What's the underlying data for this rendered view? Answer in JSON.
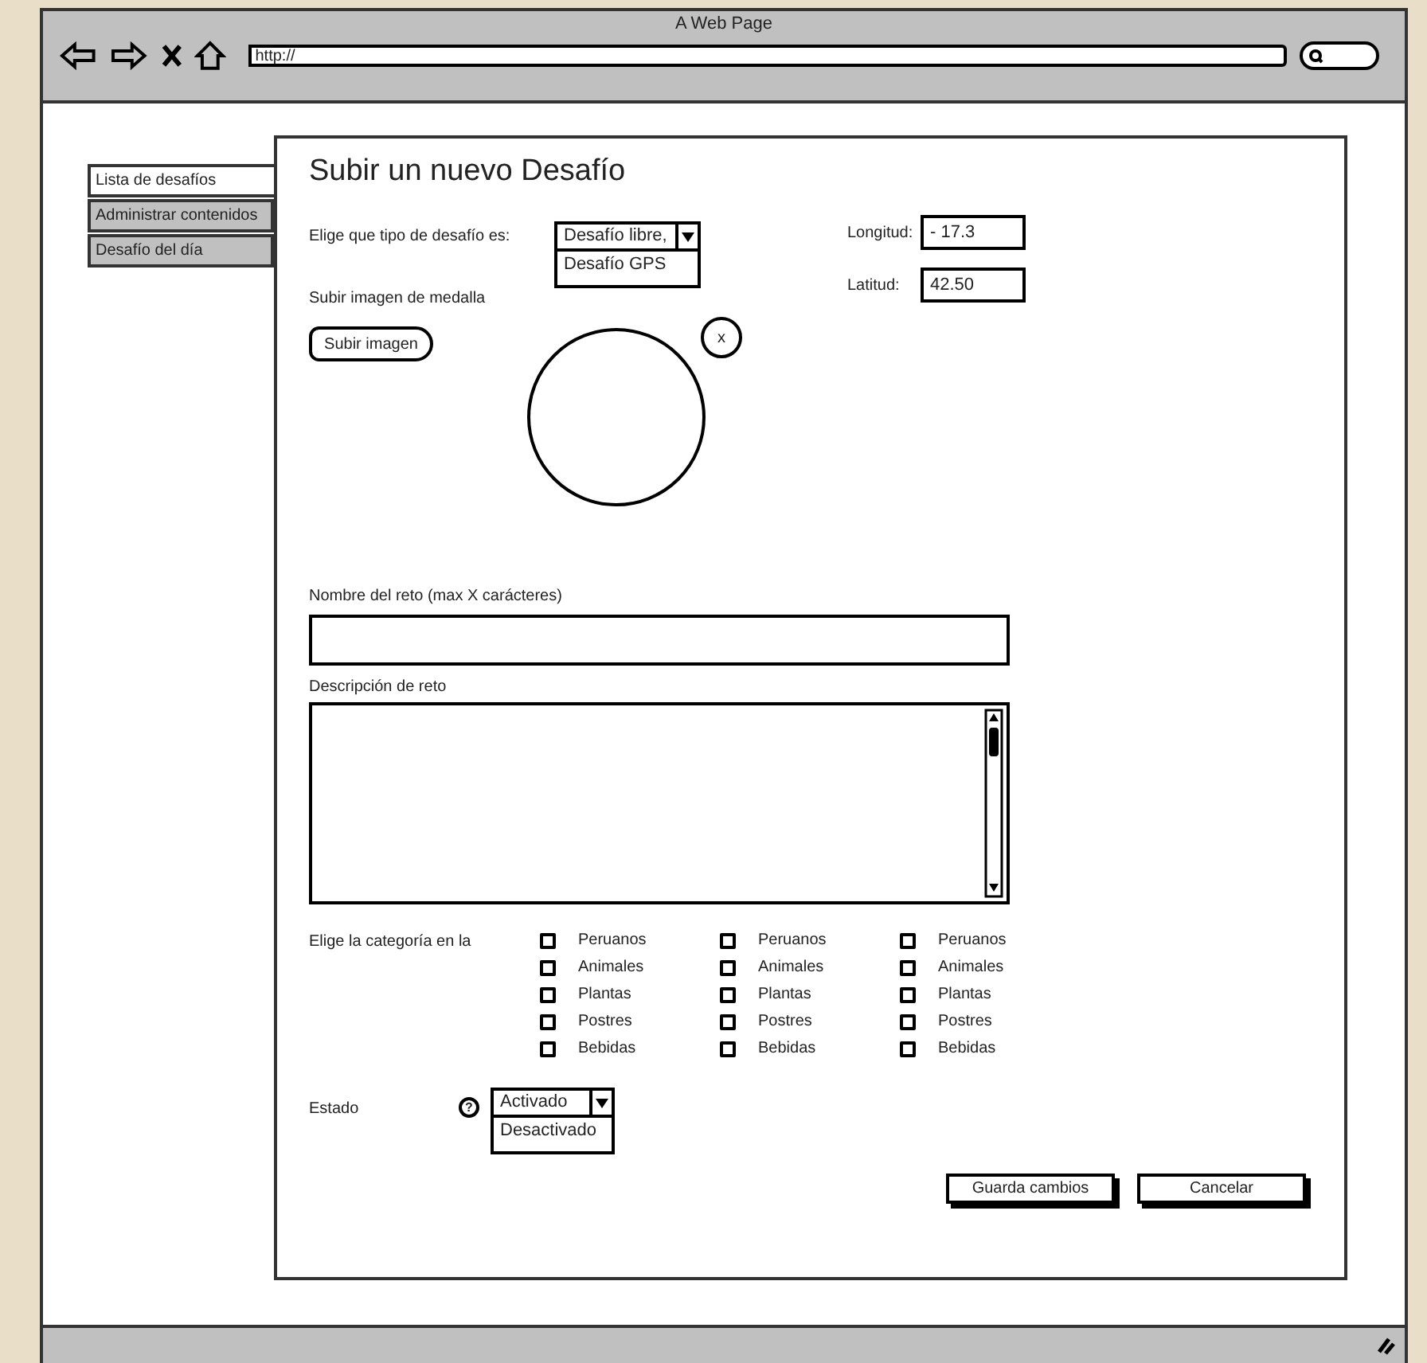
{
  "window": {
    "title": "A Web Page",
    "address": "http://"
  },
  "sidebar": {
    "tabs": [
      {
        "label": "Lista de desafíos",
        "selected": true
      },
      {
        "label": "Administrar contenidos",
        "selected": false
      },
      {
        "label": "Desafío del día",
        "selected": false
      }
    ]
  },
  "form": {
    "title": "Subir un nuevo Desafío",
    "type": {
      "label": "Elige que tipo de desafío es:",
      "value": "Desafío libre,",
      "options": [
        "Desafío GPS"
      ]
    },
    "longitude": {
      "label": "Longitud:",
      "value": "- 17.3"
    },
    "latitude": {
      "label": "Latitud:",
      "value": "42.50"
    },
    "medal": {
      "label": "Subir imagen de medalla",
      "button": "Subir imagen",
      "remove": "x"
    },
    "name": {
      "label": "Nombre del reto (max X carácteres)"
    },
    "description": {
      "label": "Descripción de reto"
    },
    "categories": {
      "label": "Elige la categoría en la",
      "columns": [
        [
          {
            "label": "Peruanos",
            "checked": false
          },
          {
            "label": "Animales",
            "checked": false
          },
          {
            "label": "Plantas",
            "checked": false
          },
          {
            "label": "Postres",
            "checked": false
          },
          {
            "label": "Bebidas",
            "checked": false
          }
        ],
        [
          {
            "label": "Peruanos",
            "checked": false
          },
          {
            "label": "Animales",
            "checked": false
          },
          {
            "label": "Plantas",
            "checked": false
          },
          {
            "label": "Postres",
            "checked": false
          },
          {
            "label": "Bebidas",
            "checked": false
          }
        ],
        [
          {
            "label": "Peruanos",
            "checked": false
          },
          {
            "label": "Animales",
            "checked": false
          },
          {
            "label": "Plantas",
            "checked": false
          },
          {
            "label": "Postres",
            "checked": false
          },
          {
            "label": "Bebidas",
            "checked": false
          }
        ]
      ]
    },
    "status": {
      "label": "Estado",
      "help": "?",
      "value": "Activado",
      "options": [
        "Desactivado"
      ]
    },
    "buttons": [
      "Guarda cambios",
      "Cancelar"
    ]
  }
}
